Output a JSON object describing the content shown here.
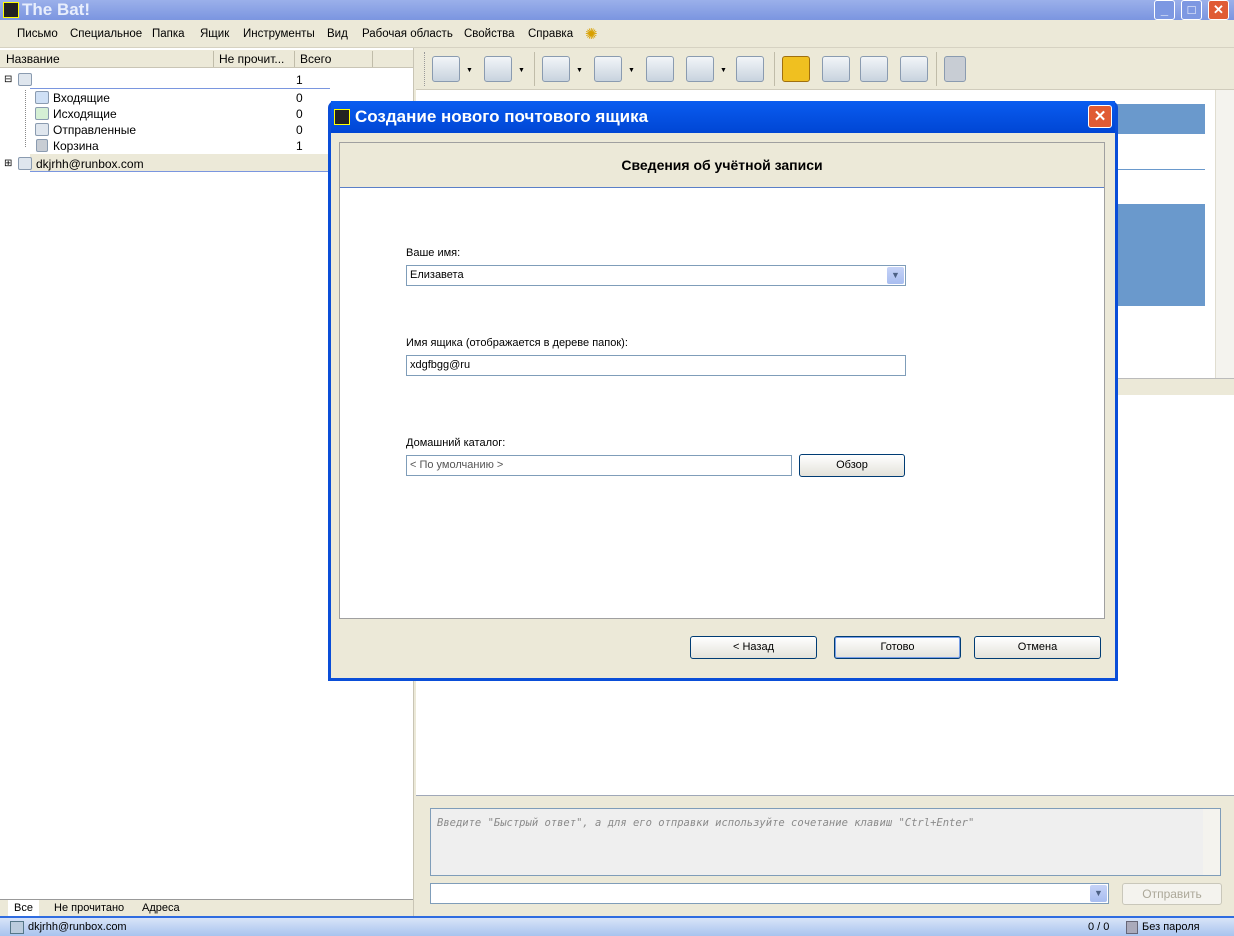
{
  "app": {
    "title": "The Bat!"
  },
  "menu": [
    "Письмо",
    "Специальное",
    "Папка",
    "Ящик",
    "Инструменты",
    "Вид",
    "Рабочая область",
    "Свойства",
    "Справка"
  ],
  "folders": {
    "columns": [
      "Название",
      "Не прочит...",
      "Всего"
    ],
    "root_total": "1",
    "items": [
      {
        "name": "Входящие",
        "total": "0",
        "icon": "inbox-icon"
      },
      {
        "name": "Исходящие",
        "total": "0",
        "icon": "outbox-icon"
      },
      {
        "name": "Отправленные",
        "total": "0",
        "icon": "sent-icon"
      },
      {
        "name": "Корзина",
        "total": "1",
        "icon": "trash-icon"
      }
    ],
    "account": "dkjrhh@runbox.com"
  },
  "toolbar_icons": [
    "get-mail-icon",
    "send-mail-icon",
    "new-message-icon",
    "reply-icon",
    "reply-all-icon",
    "forward-icon",
    "redirect-icon",
    "address-book-icon",
    "find-icon",
    "save-icon",
    "print-icon",
    "delete-icon"
  ],
  "tabs": [
    "Все",
    "Не прочитано",
    "Адреса"
  ],
  "quick_reply": {
    "placeholder": "Введите \"Быстрый ответ\", а для его отправки используйте сочетание клавиш \"Ctrl+Enter\"",
    "send": "Отправить"
  },
  "status": {
    "account": "dkjrhh@runbox.com",
    "count": "0 / 0",
    "password": "Без пароля"
  },
  "dialog": {
    "title": "Создание нового почтового ящика",
    "header": "Сведения об учётной записи",
    "name_label": "Ваше имя:",
    "name_value": "Елизавета",
    "box_label": "Имя ящика (отображается в дереве папок):",
    "box_value": "xdgfbgg@ru",
    "dir_label": "Домашний каталог:",
    "dir_value": "< По умолчанию >",
    "browse": "Обзор",
    "back": "< Назад",
    "finish": "Готово",
    "cancel": "Отмена"
  }
}
